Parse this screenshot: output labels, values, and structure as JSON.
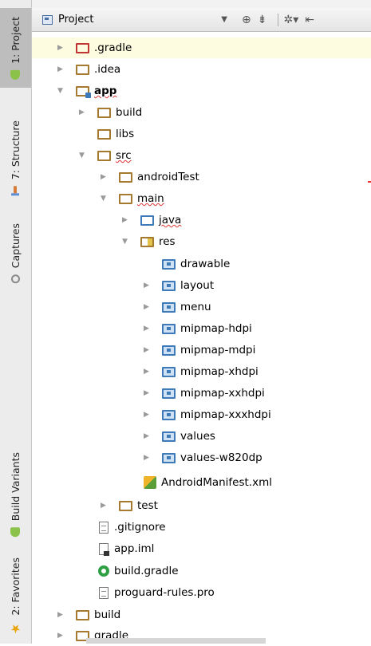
{
  "sidebar": {
    "tabs": [
      {
        "label": "1: Project",
        "icon": "android-icon",
        "active": true
      },
      {
        "label": "7: Structure",
        "icon": "structure-icon",
        "active": false
      },
      {
        "label": "Captures",
        "icon": "captures-icon",
        "active": false
      },
      {
        "label": "Build Variants",
        "icon": "android-icon",
        "active": false
      },
      {
        "label": "2: Favorites",
        "icon": "star-icon",
        "active": false
      }
    ]
  },
  "header": {
    "view_label": "Project",
    "icons": [
      "target-icon",
      "collapse-icon",
      "gear-icon",
      "hide-icon"
    ]
  },
  "tree": [
    {
      "label": ".gradle",
      "expanded": false,
      "icon": "folder-red",
      "selected": true
    },
    {
      "label": ".idea",
      "expanded": false,
      "icon": "folder"
    },
    {
      "label": "app",
      "expanded": true,
      "icon": "module-folder"
    },
    {
      "label": "build",
      "expanded": false,
      "icon": "folder"
    },
    {
      "label": "libs",
      "icon": "folder"
    },
    {
      "label": "src",
      "expanded": true,
      "icon": "folder"
    },
    {
      "label": "androidTest",
      "expanded": false,
      "icon": "folder"
    },
    {
      "label": "main",
      "expanded": true,
      "icon": "folder"
    },
    {
      "label": "java",
      "expanded": false,
      "icon": "source-folder"
    },
    {
      "label": "res",
      "expanded": true,
      "icon": "resource-folder"
    },
    {
      "label": "drawable",
      "icon": "package-folder"
    },
    {
      "label": "layout",
      "expanded": false,
      "icon": "package-folder"
    },
    {
      "label": "menu",
      "expanded": false,
      "icon": "package-folder"
    },
    {
      "label": "mipmap-hdpi",
      "expanded": false,
      "icon": "package-folder"
    },
    {
      "label": "mipmap-mdpi",
      "expanded": false,
      "icon": "package-folder"
    },
    {
      "label": "mipmap-xhdpi",
      "expanded": false,
      "icon": "package-folder"
    },
    {
      "label": "mipmap-xxhdpi",
      "expanded": false,
      "icon": "package-folder"
    },
    {
      "label": "mipmap-xxxhdpi",
      "expanded": false,
      "icon": "package-folder"
    },
    {
      "label": "values",
      "expanded": false,
      "icon": "package-folder"
    },
    {
      "label": "values-w820dp",
      "expanded": false,
      "icon": "package-folder"
    },
    {
      "label": "AndroidManifest.xml",
      "icon": "manifest-icon"
    },
    {
      "label": "test",
      "expanded": false,
      "icon": "folder"
    },
    {
      "label": ".gitignore",
      "icon": "text-file-icon"
    },
    {
      "label": "app.iml",
      "icon": "iml-file-icon"
    },
    {
      "label": "build.gradle",
      "icon": "gradle-icon"
    },
    {
      "label": "proguard-rules.pro",
      "icon": "text-file-icon"
    },
    {
      "label": "build",
      "expanded": false,
      "icon": "folder"
    },
    {
      "label": "gradle",
      "expanded": false,
      "icon": "folder"
    }
  ]
}
